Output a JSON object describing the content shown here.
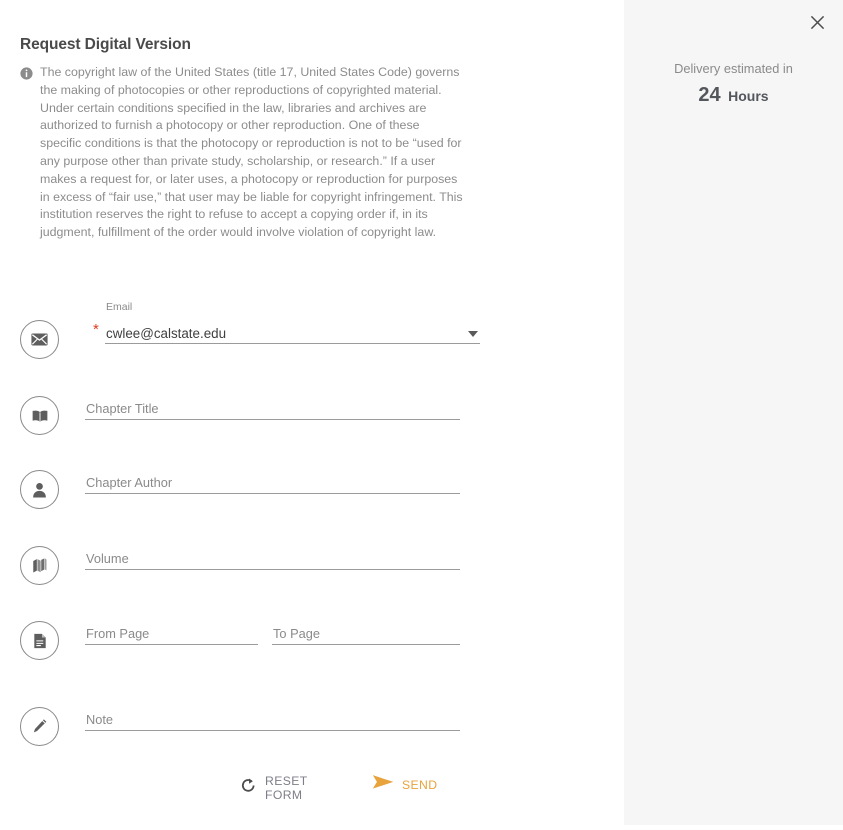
{
  "form": {
    "title": "Request Digital Version",
    "notice": {
      "icon": "info-icon",
      "text": "The copyright law of the United States (title 17, United States Code) governs the making of photocopies or other reproductions of copyrighted material. Under certain conditions specified in the law, libraries and archives are authorized to furnish a photocopy or other reproduction. One of these specific conditions is that the photocopy or reproduction is not to be “used for any purpose other than private study, scholarship, or research.” If a user makes a request for, or later uses, a photocopy or reproduction for purposes in excess of “fair use,” that user may be liable for copyright infringement. This institution reserves the right to refuse to accept a copying order if, in its judgment, fulfillment of the order would involve violation of copyright law."
    },
    "fields": {
      "email": {
        "icon": "envelope-icon",
        "label": "Email",
        "value": "cwlee@calstate.edu",
        "required_marker": "*",
        "has_dropdown": true
      },
      "chapter_title": {
        "icon": "book-open-icon",
        "placeholder": "Chapter Title",
        "value": ""
      },
      "chapter_author": {
        "icon": "person-icon",
        "placeholder": "Chapter Author",
        "value": ""
      },
      "volume": {
        "icon": "books-stack-icon",
        "placeholder": "Volume",
        "value": ""
      },
      "pages": {
        "icon": "document-icon",
        "from_placeholder": "From Page",
        "from_value": "",
        "to_placeholder": "To Page",
        "to_value": ""
      },
      "note": {
        "icon": "pencil-icon",
        "placeholder": "Note",
        "value": ""
      }
    },
    "actions": {
      "reset": {
        "label": "RESET FORM",
        "icon": "refresh-icon",
        "color": "#7d7f88"
      },
      "send": {
        "label": "SEND",
        "icon": "send-plane-icon",
        "color": "#e8a33d"
      }
    }
  },
  "delivery_panel": {
    "close_icon": "close-icon",
    "estimate_label": "Delivery estimated in",
    "estimate_value": "24",
    "estimate_unit": "Hours",
    "background": "#f6f6f6"
  }
}
